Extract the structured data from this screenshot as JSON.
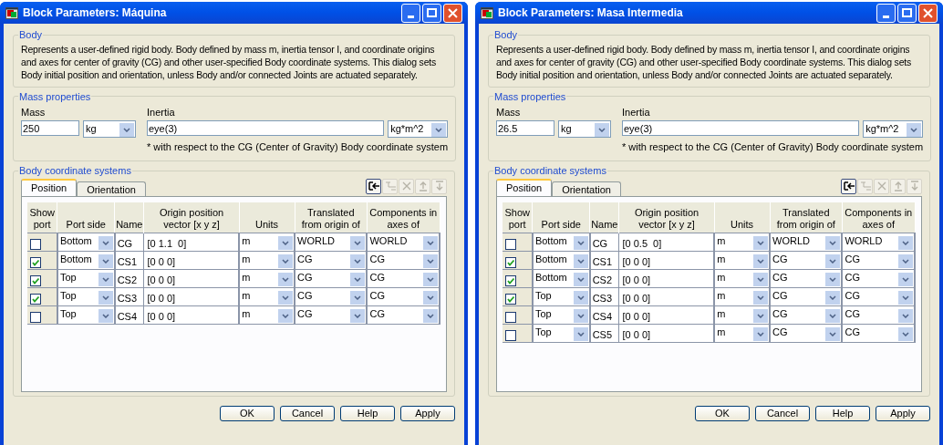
{
  "windows": [
    {
      "title": "Block Parameters: Máquina",
      "body": {
        "legend": "Body",
        "description": "Represents a user-defined rigid body. Body defined by mass m, inertia tensor I, and coordinate origins and axes for center of gravity (CG) and other user-specified Body coordinate systems. This dialog sets Body initial position and orientation, unless Body and/or connected Joints are actuated separately."
      },
      "mass_properties": {
        "legend": "Mass properties",
        "mass_label": "Mass",
        "mass": "250",
        "mass_unit": "kg",
        "inertia_label": "Inertia",
        "inertia": "eye(3)",
        "inertia_unit": "kg*m^2",
        "note": "* with respect to the CG (Center of Gravity) Body coordinate system"
      },
      "coordinate_systems": {
        "legend": "Body coordinate systems",
        "tabs": [
          {
            "label": "Position",
            "selected": true
          },
          {
            "label": "Orientation",
            "selected": false
          }
        ],
        "toolbar": [
          {
            "kind": "add",
            "disabled": false
          },
          {
            "kind": "indent",
            "disabled": true
          },
          {
            "kind": "delete",
            "disabled": true
          },
          {
            "kind": "up",
            "disabled": true
          },
          {
            "kind": "down",
            "disabled": true
          }
        ],
        "columns": [
          "Show port",
          "Port side",
          "Name",
          "Origin position vector [x y z]",
          "Units",
          "Translated from origin of",
          "Components in axes of"
        ],
        "rows": [
          {
            "show_port": false,
            "port_side": "Bottom",
            "name": "CG",
            "origin": "[0 1.1  0]",
            "units": "m",
            "translated_from": "WORLD",
            "components_in": "WORLD"
          },
          {
            "show_port": true,
            "port_side": "Bottom",
            "name": "CS1",
            "origin": "[0 0 0]",
            "units": "m",
            "translated_from": "CG",
            "components_in": "CG"
          },
          {
            "show_port": true,
            "port_side": "Top",
            "name": "CS2",
            "origin": "[0 0 0]",
            "units": "m",
            "translated_from": "CG",
            "components_in": "CG"
          },
          {
            "show_port": true,
            "port_side": "Top",
            "name": "CS3",
            "origin": "[0 0 0]",
            "units": "m",
            "translated_from": "CG",
            "components_in": "CG"
          },
          {
            "show_port": false,
            "port_side": "Top",
            "name": "CS4",
            "origin": "[0 0 0]",
            "units": "m",
            "translated_from": "CG",
            "components_in": "CG"
          }
        ]
      },
      "buttons": [
        "OK",
        "Cancel",
        "Help",
        "Apply"
      ]
    },
    {
      "title": "Block Parameters: Masa Intermedia",
      "body": {
        "legend": "Body",
        "description": "Represents a user-defined rigid body. Body defined by mass m, inertia tensor I, and coordinate origins and axes for center of gravity (CG) and other user-specified Body coordinate systems. This dialog sets Body initial position and orientation, unless Body and/or connected Joints are actuated separately."
      },
      "mass_properties": {
        "legend": "Mass properties",
        "mass_label": "Mass",
        "mass": "26.5",
        "mass_unit": "kg",
        "inertia_label": "Inertia",
        "inertia": "eye(3)",
        "inertia_unit": "kg*m^2",
        "note": "* with respect to the CG (Center of Gravity) Body coordinate system"
      },
      "coordinate_systems": {
        "legend": "Body coordinate systems",
        "tabs": [
          {
            "label": "Position",
            "selected": true
          },
          {
            "label": "Orientation",
            "selected": false
          }
        ],
        "toolbar": [
          {
            "kind": "add",
            "disabled": false
          },
          {
            "kind": "indent",
            "disabled": true
          },
          {
            "kind": "delete",
            "disabled": true
          },
          {
            "kind": "up",
            "disabled": true
          },
          {
            "kind": "down",
            "disabled": true
          }
        ],
        "columns": [
          "Show port",
          "Port side",
          "Name",
          "Origin position vector [x y z]",
          "Units",
          "Translated from origin of",
          "Components in axes of"
        ],
        "rows": [
          {
            "show_port": false,
            "port_side": "Bottom",
            "name": "CG",
            "origin": "[0 0.5  0]",
            "units": "m",
            "translated_from": "WORLD",
            "components_in": "WORLD"
          },
          {
            "show_port": true,
            "port_side": "Bottom",
            "name": "CS1",
            "origin": "[0 0 0]",
            "units": "m",
            "translated_from": "CG",
            "components_in": "CG"
          },
          {
            "show_port": true,
            "port_side": "Bottom",
            "name": "CS2",
            "origin": "[0 0 0]",
            "units": "m",
            "translated_from": "CG",
            "components_in": "CG"
          },
          {
            "show_port": true,
            "port_side": "Top",
            "name": "CS3",
            "origin": "[0 0 0]",
            "units": "m",
            "translated_from": "CG",
            "components_in": "CG"
          },
          {
            "show_port": false,
            "port_side": "Top",
            "name": "CS4",
            "origin": "[0 0 0]",
            "units": "m",
            "translated_from": "CG",
            "components_in": "CG"
          },
          {
            "show_port": false,
            "port_side": "Top",
            "name": "CS5",
            "origin": "[0 0 0]",
            "units": "m",
            "translated_from": "CG",
            "components_in": "CG"
          }
        ]
      },
      "buttons": [
        "OK",
        "Cancel",
        "Help",
        "Apply"
      ]
    }
  ]
}
